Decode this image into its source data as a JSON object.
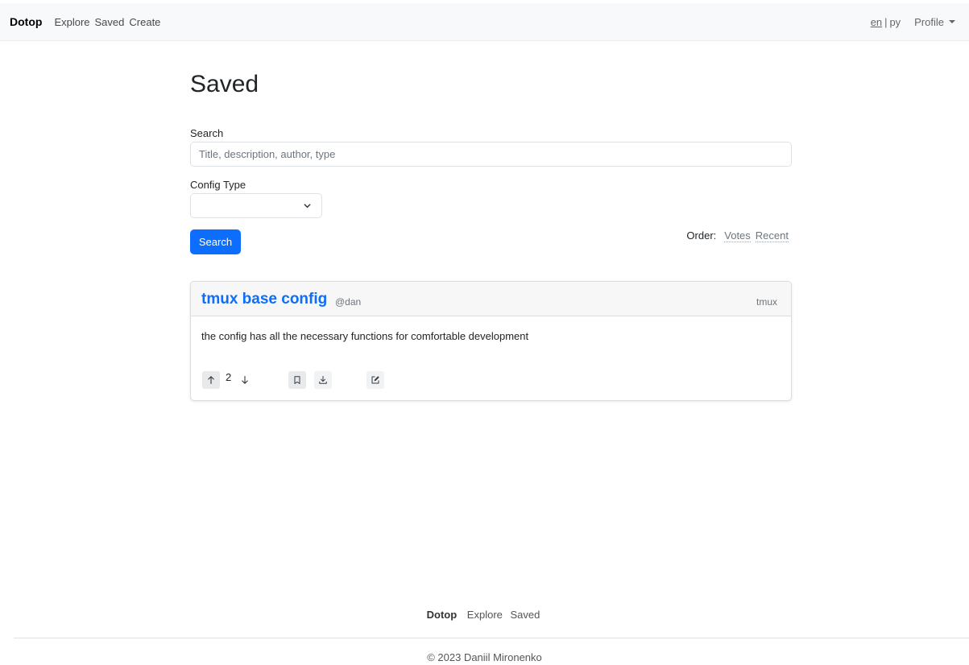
{
  "navbar": {
    "brand": "Dotop",
    "links": [
      "Explore",
      "Saved",
      "Create"
    ],
    "lang": {
      "current": "en",
      "separator": "|",
      "other": "ру"
    },
    "profile": "Profile"
  },
  "page": {
    "title": "Saved"
  },
  "search": {
    "label": "Search",
    "placeholder": "Title, description, author, type",
    "value": ""
  },
  "config_type": {
    "label": "Config Type",
    "selected": ""
  },
  "search_button": "Search",
  "order": {
    "label": "Order:",
    "options": [
      "Votes",
      "Recent"
    ]
  },
  "configs": [
    {
      "title": "tmux base config",
      "author": "@dan",
      "type": "tmux",
      "description": "the config has all the necessary functions for comfortable development",
      "votes": "2"
    }
  ],
  "icons": {
    "upvote": "arrow-up-icon",
    "downvote": "arrow-down-icon",
    "save": "bookmark-icon",
    "download": "download-icon",
    "edit": "edit-icon",
    "select": "chevron-down-icon"
  },
  "colors": {
    "primary": "#0d6efd",
    "navbar_bg": "#f8f9fa",
    "card_header_bg": "#f7f7f7"
  },
  "footer": {
    "brand": "Dotop",
    "links": [
      "Explore",
      "Saved"
    ],
    "copyright": "© 2023 Daniil Mironenko"
  }
}
